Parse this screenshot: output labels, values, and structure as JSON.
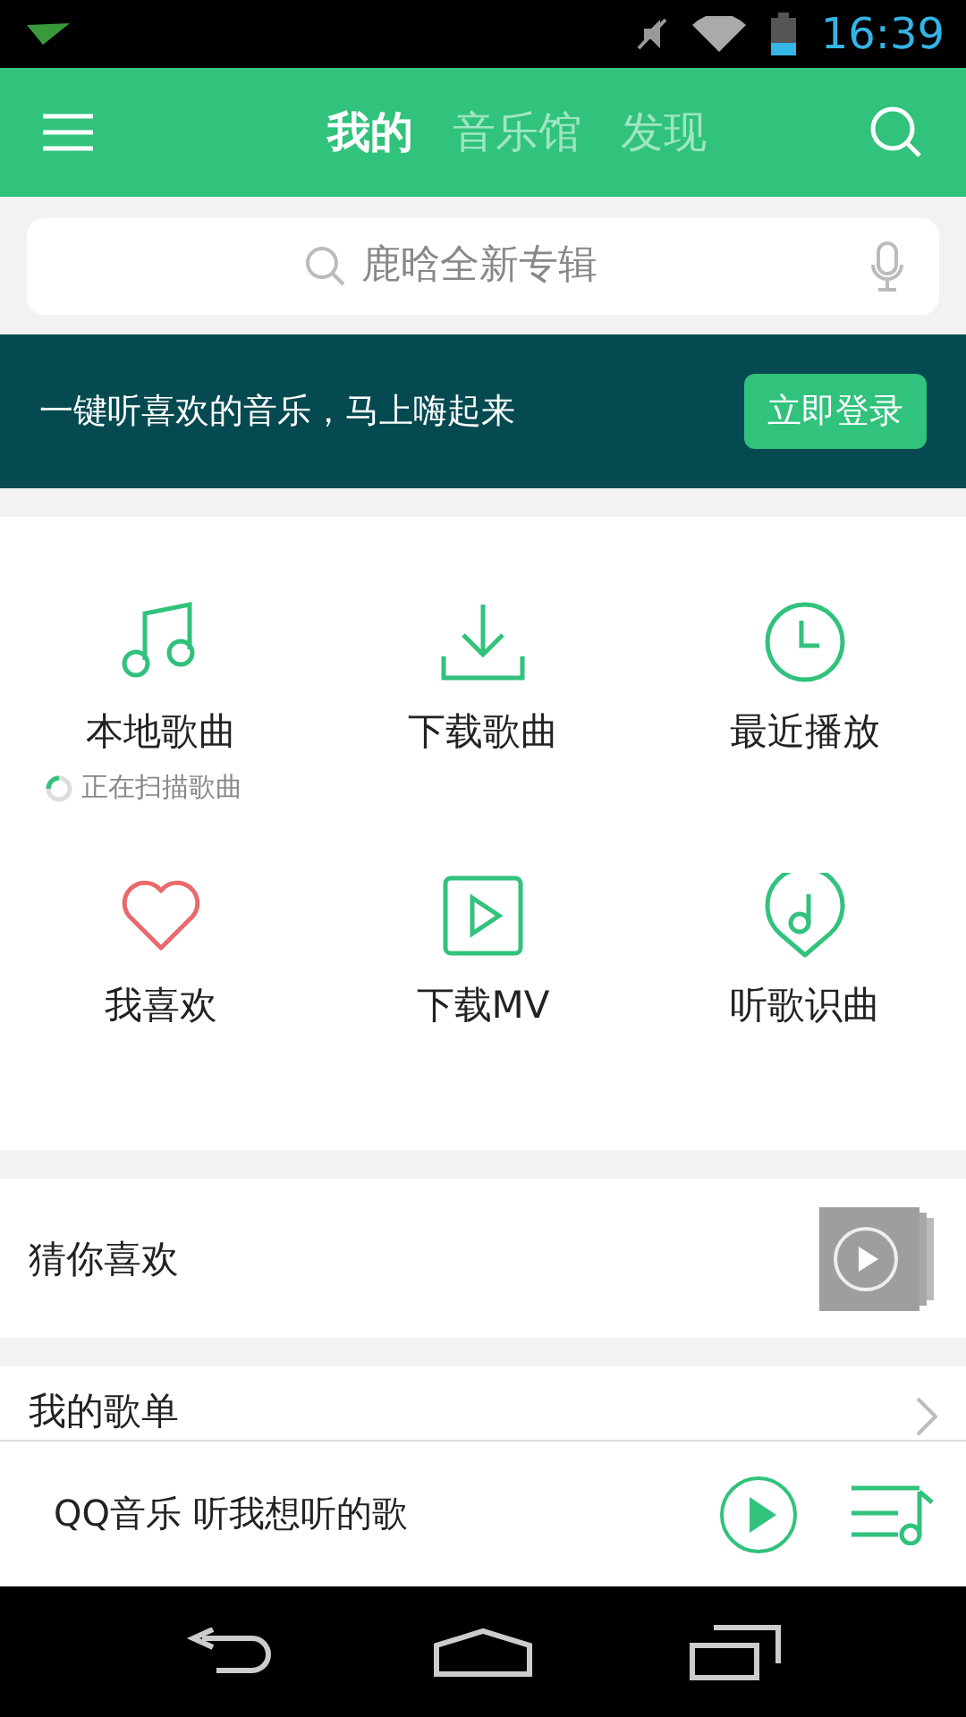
{
  "status_bar": {
    "time": "16:39"
  },
  "header": {
    "tabs": [
      {
        "label": "我的",
        "selected": true
      },
      {
        "label": "音乐馆",
        "selected": false
      },
      {
        "label": "发现",
        "selected": false
      }
    ]
  },
  "search": {
    "placeholder": "鹿晗全新专辑"
  },
  "login_banner": {
    "text": "一键听喜欢的音乐，马上嗨起来",
    "button": "立即登录"
  },
  "shortcuts": [
    {
      "kind": "music",
      "label": "本地歌曲",
      "status": "正在扫描歌曲"
    },
    {
      "kind": "download",
      "label": "下载歌曲"
    },
    {
      "kind": "clock",
      "label": "最近播放"
    },
    {
      "kind": "heart",
      "label": "我喜欢"
    },
    {
      "kind": "video",
      "label": "下载MV"
    },
    {
      "kind": "recognize",
      "label": "听歌识曲"
    }
  ],
  "sections": [
    {
      "kind": "guess",
      "title": "猜你喜欢"
    },
    {
      "kind": "link",
      "title": "我的歌单"
    }
  ],
  "mini_player": {
    "text": "QQ音乐 听我想听的歌"
  }
}
